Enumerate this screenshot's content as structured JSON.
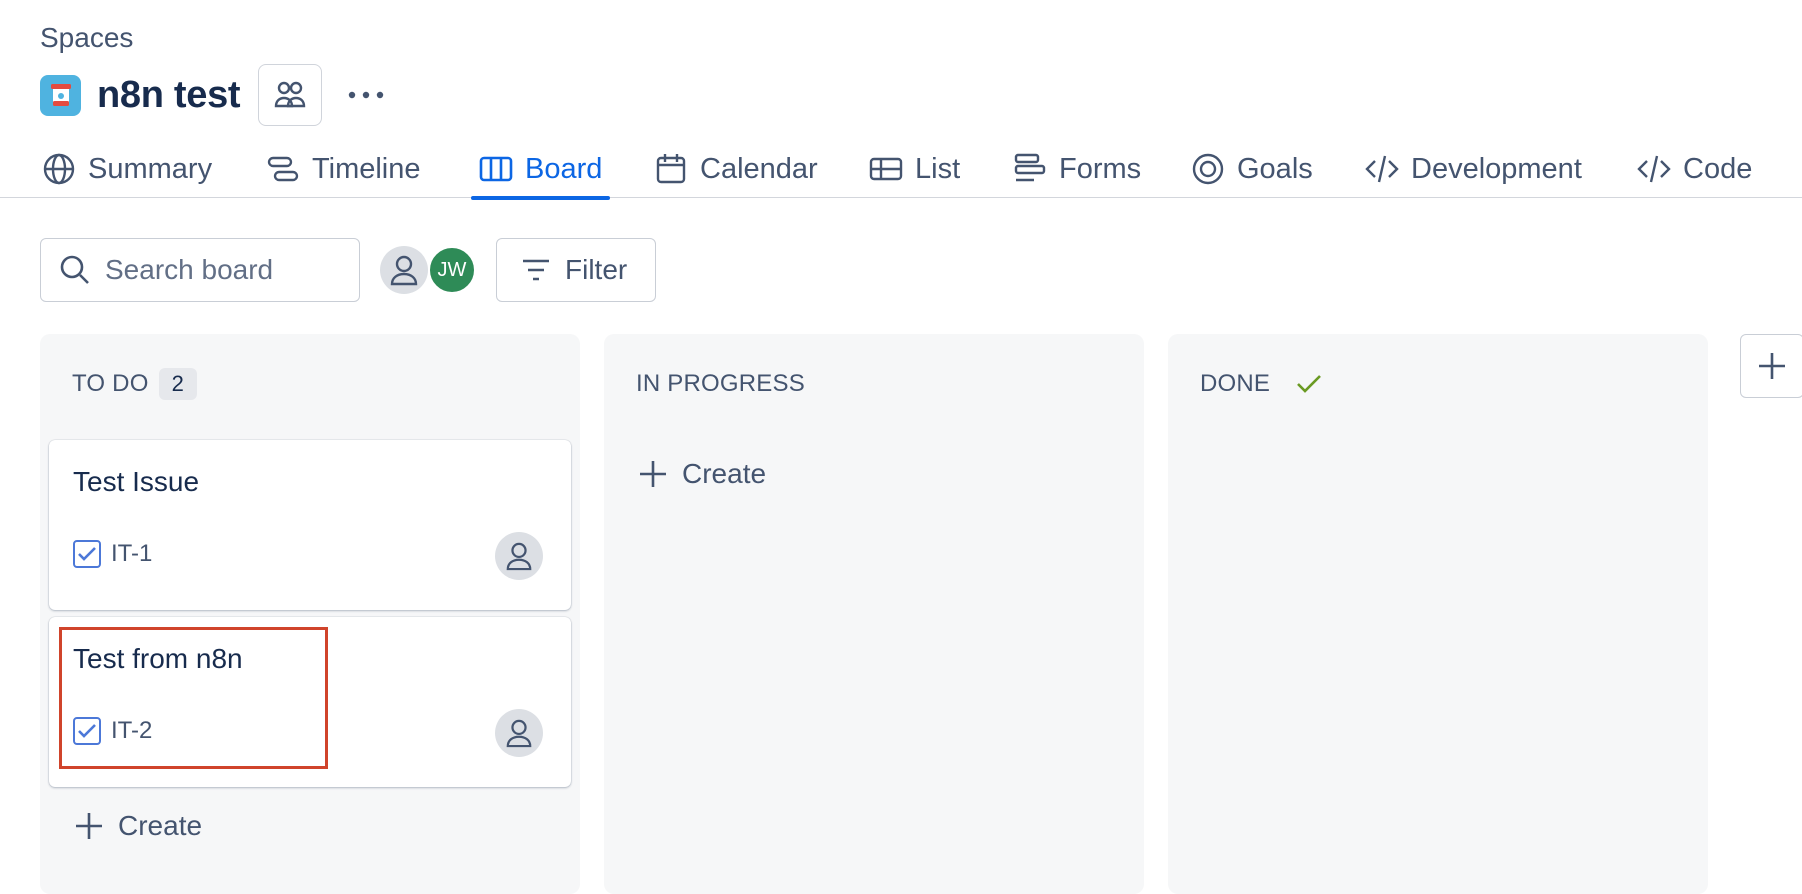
{
  "breadcrumb": "Spaces",
  "project": {
    "title": "n8n test"
  },
  "tabs": [
    {
      "label": "Summary",
      "icon": "globe-icon"
    },
    {
      "label": "Timeline",
      "icon": "timeline-icon"
    },
    {
      "label": "Board",
      "icon": "board-icon",
      "active": true
    },
    {
      "label": "Calendar",
      "icon": "calendar-icon"
    },
    {
      "label": "List",
      "icon": "list-icon"
    },
    {
      "label": "Forms",
      "icon": "forms-icon"
    },
    {
      "label": "Goals",
      "icon": "goals-icon"
    },
    {
      "label": "Development",
      "icon": "code-icon"
    },
    {
      "label": "Code",
      "icon": "code-icon"
    }
  ],
  "toolbar": {
    "search_placeholder": "Search board",
    "avatar_initials": "JW",
    "filter_label": "Filter"
  },
  "columns": [
    {
      "name": "TO DO",
      "count": "2",
      "cards": [
        {
          "title": "Test Issue",
          "key": "IT-1"
        },
        {
          "title": "Test from n8n",
          "key": "IT-2"
        }
      ],
      "create_label": "Create"
    },
    {
      "name": "IN PROGRESS",
      "cards": [],
      "create_label": "Create"
    },
    {
      "name": "DONE",
      "cards": []
    }
  ],
  "colors": {
    "accent": "#0c66e4",
    "highlight": "#d0442b",
    "done_check": "#6a9a23"
  }
}
